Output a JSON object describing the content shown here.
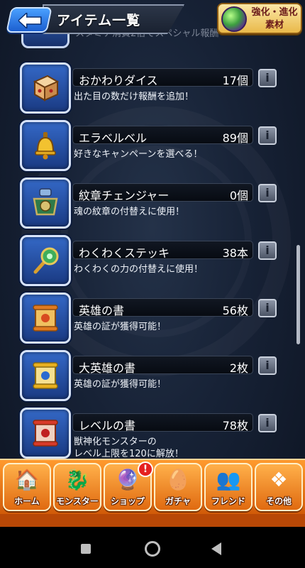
{
  "header": {
    "title": "アイテム一覧",
    "material_button_label": "強化・進化\n素材",
    "back_icon": "arrow-left-icon"
  },
  "peek_item": {
    "name": "スタミナ消費2倍でスペシャル報酬"
  },
  "items": [
    {
      "name": "おかわりダイス",
      "count": "17個",
      "desc": "出た目の数だけ報酬を追加！",
      "icon": "dice-icon"
    },
    {
      "name": "エラベルベル",
      "count": "89個",
      "desc": "好きなキャンペーンを選べる！",
      "icon": "bell-icon"
    },
    {
      "name": "紋章チェンジャー",
      "count": "0個",
      "desc": "魂の紋章の付替えに使用！",
      "icon": "emblem-changer-icon"
    },
    {
      "name": "わくわくステッキ",
      "count": "38本",
      "desc": "わくわくの力の付替えに使用！",
      "icon": "wand-icon"
    },
    {
      "name": "英雄の書",
      "count": "56枚",
      "desc": "英雄の証が獲得可能！",
      "icon": "scroll-icon"
    },
    {
      "name": "大英雄の書",
      "count": "2枚",
      "desc": "英雄の証が獲得可能！",
      "icon": "scroll-gold-icon"
    },
    {
      "name": "レベルの書",
      "count": "78枚",
      "desc": "獣神化モンスターの\nレベル上限を120に解放！",
      "icon": "scroll-red-icon"
    }
  ],
  "info_label": "i",
  "bottom_nav": [
    {
      "label": "ホーム",
      "icon": "home-icon"
    },
    {
      "label": "モンスター",
      "icon": "monster-icon"
    },
    {
      "label": "ショップ",
      "icon": "shop-orb-icon",
      "badge": "!"
    },
    {
      "label": "ガチャ",
      "icon": "gacha-icon"
    },
    {
      "label": "フレンド",
      "icon": "friend-icon"
    },
    {
      "label": "その他",
      "icon": "other-icon"
    }
  ]
}
